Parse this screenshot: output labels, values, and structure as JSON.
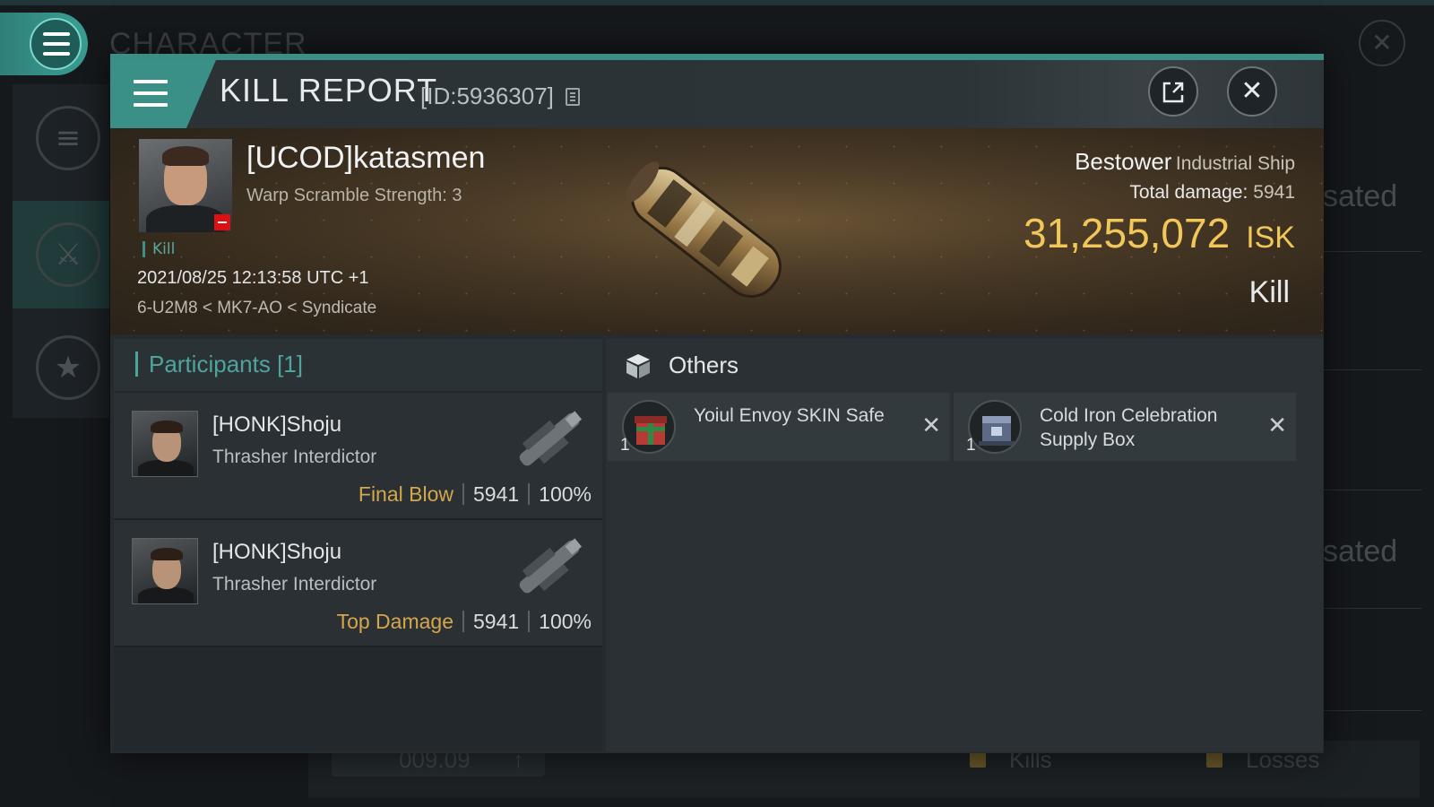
{
  "background": {
    "title": "CHARACTER",
    "right_labels": [
      "sated",
      "sated"
    ],
    "bottom": {
      "value": "009.09",
      "arrow": "↑",
      "kills": "Kills",
      "losses": "Losses"
    }
  },
  "header": {
    "title": "KILL REPORT",
    "id_label": "[ID:5936307]",
    "share_icon": "share-icon",
    "close_icon": "close-icon"
  },
  "victim": {
    "name": "[UCOD]katasmen",
    "subtitle": "Warp Scramble Strength: 3",
    "tag": "Kill",
    "datetime": "2021/08/25 12:13:58 UTC +1",
    "location": "6-U2M8 < MK7-AO < Syndicate"
  },
  "ship": {
    "name": "Bestower",
    "class": "Industrial Ship",
    "total_damage_label": "Total damage:",
    "total_damage": "5941",
    "isk_amount": "31,255,072",
    "isk_unit": "ISK",
    "result": "Kill"
  },
  "participants": {
    "title": "Participants [1]",
    "rows": [
      {
        "name": "[HONK]Shoju",
        "ship": "Thrasher Interdictor",
        "label": "Final Blow",
        "damage": "5941",
        "percent": "100%"
      },
      {
        "name": "[HONK]Shoju",
        "ship": "Thrasher Interdictor",
        "label": "Top Damage",
        "damage": "5941",
        "percent": "100%"
      }
    ]
  },
  "others": {
    "title": "Others",
    "items": [
      {
        "qty": "1",
        "name": "Yoiul Envoy SKIN Safe",
        "icon": "gift-box-icon"
      },
      {
        "qty": "1",
        "name": "Cold Iron Celebration Supply Box",
        "icon": "supply-crate-icon"
      }
    ]
  },
  "colors": {
    "accent": "#3a8f87",
    "isk": "#f2c75a",
    "label": "#d5a74a",
    "teal_text": "#4fa49d"
  }
}
